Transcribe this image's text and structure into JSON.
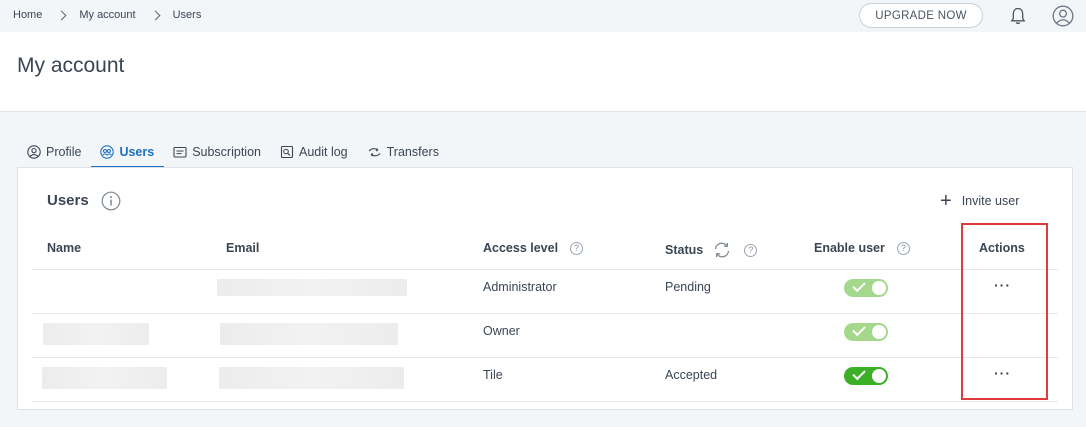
{
  "breadcrumb": [
    "Home",
    "My account",
    "Users"
  ],
  "topbar": {
    "upgrade_label": "UPGRADE NOW"
  },
  "header": {
    "title": "My account"
  },
  "tabs": [
    {
      "label": "Profile",
      "icon": "profile-icon",
      "active": false
    },
    {
      "label": "Users",
      "icon": "users-icon",
      "active": true
    },
    {
      "label": "Subscription",
      "icon": "subscription-icon",
      "active": false
    },
    {
      "label": "Audit log",
      "icon": "audit-log-icon",
      "active": false
    },
    {
      "label": "Transfers",
      "icon": "transfers-icon",
      "active": false
    }
  ],
  "card": {
    "title": "Users",
    "invite_label": "Invite user",
    "columns": [
      "Name",
      "Email",
      "Access level",
      "Status",
      "Enable user",
      "Actions"
    ],
    "rows": [
      {
        "name": "",
        "email": "",
        "access_level": "Administrator",
        "status": "Pending",
        "enabled": true,
        "toggle_state": "disabled",
        "actions": "···"
      },
      {
        "name": "",
        "email": "",
        "access_level": "Owner",
        "status": "",
        "enabled": true,
        "toggle_state": "disabled",
        "actions": ""
      },
      {
        "name": "",
        "email": "",
        "access_level": "Tile",
        "status": "Accepted",
        "enabled": true,
        "toggle_state": "active",
        "actions": "···"
      }
    ]
  },
  "colors": {
    "accent": "#1f6fbf",
    "toggle_active": "#3bb027",
    "toggle_disabled": "#a3d88d",
    "highlight": "#e0393e"
  }
}
